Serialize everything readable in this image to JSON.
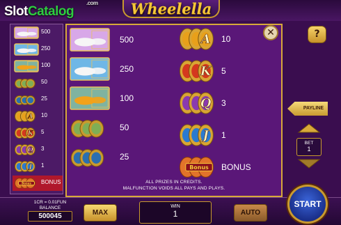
{
  "watermark": {
    "brand_a": "Slot",
    "brand_b": "Catalog",
    "tld": ".com"
  },
  "game": {
    "title": "Wheelella"
  },
  "left_paytable": [
    {
      "symbol": "jet-ski",
      "pay": "500"
    },
    {
      "symbol": "yacht",
      "pay": "250"
    },
    {
      "symbol": "sports-car",
      "pay": "100"
    },
    {
      "symbol": "money-stack",
      "pay": "50"
    },
    {
      "symbol": "watch",
      "pay": "25"
    },
    {
      "symbol": "letter-a",
      "pay": "10"
    },
    {
      "symbol": "letter-k",
      "pay": "5"
    },
    {
      "symbol": "letter-q",
      "pay": "3"
    },
    {
      "symbol": "letter-j",
      "pay": "1"
    },
    {
      "symbol": "bonus",
      "pay": "BONUS"
    }
  ],
  "paytable": {
    "left": [
      {
        "symbol": "jet-ski",
        "pay": "500"
      },
      {
        "symbol": "yacht",
        "pay": "250"
      },
      {
        "symbol": "sports-car",
        "pay": "100"
      },
      {
        "symbol": "money-stack",
        "pay": "50"
      },
      {
        "symbol": "watch",
        "pay": "25"
      }
    ],
    "right": [
      {
        "symbol": "letter-a",
        "letter": "A",
        "pay": "10"
      },
      {
        "symbol": "letter-k",
        "letter": "K",
        "pay": "5"
      },
      {
        "symbol": "letter-q",
        "letter": "Q",
        "pay": "3"
      },
      {
        "symbol": "letter-j",
        "letter": "J",
        "pay": "1"
      },
      {
        "symbol": "bonus",
        "letter": "Bonus",
        "pay": "BONUS"
      }
    ],
    "note_line1": "ALL PRIZES IN CREDITS.",
    "note_line2": "MALFUNCTION VOIDS ALL PAYS AND PLAYS."
  },
  "controls": {
    "close_icon": "close-icon",
    "help_label": "?",
    "payline_label": "PAYLINE",
    "bet_label": "BET",
    "bet_value": "1",
    "coin_rate": "1CR = 0.01FUN",
    "balance_label": "BALANCE",
    "balance_value": "500045",
    "max_label": "MAX",
    "win_label": "WIN",
    "win_value": "1",
    "auto_label": "AUTO",
    "start_label": "START"
  },
  "colors": {
    "background": "#3a0d4f",
    "panel": "#5a1778",
    "gold": "#d8a93a",
    "bonus_highlight": "#b0182b",
    "start_blue": "#1a2f8a"
  }
}
